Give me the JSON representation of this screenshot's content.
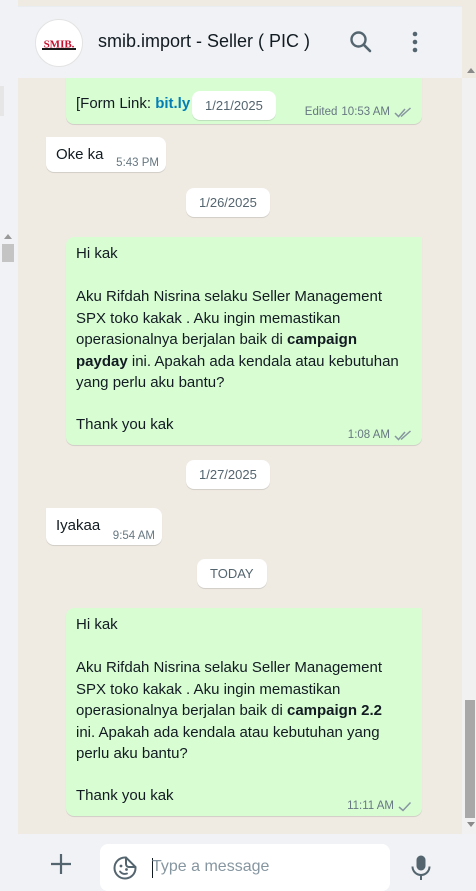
{
  "header": {
    "avatar_text": "SMIB.",
    "title": "smib.import - Seller ( PIC )",
    "search_icon": "search-icon",
    "menu_icon": "kebab-menu-icon"
  },
  "messages": {
    "m0": {
      "prefix": "[Form Link: ",
      "link": "bit.ly",
      "edited": "Edited",
      "time": "10:53 AM"
    },
    "floating_date": "1/21/2025",
    "m1": {
      "text": "Oke ka",
      "time": "5:43 PM"
    },
    "date2": "1/26/2025",
    "m2": {
      "greeting": "Hi kak",
      "l1": "Aku Rifdah Nisrina selaku Seller Management",
      "l2": "SPX toko kakak . Aku ingin memastikan",
      "l3a": "operasionalnya berjalan baik di ",
      "l3b": "campaign",
      "l4a": "payday",
      "l4b": " ini. Apakah ada kendala atau kebutuhan",
      "l5": "yang perlu aku bantu?",
      "closing": "Thank you kak",
      "time": "1:08 AM"
    },
    "date3": "1/27/2025",
    "m3": {
      "text": "Iyakaa",
      "time": "9:54 AM"
    },
    "date4": "TODAY",
    "m4": {
      "greeting": "Hi kak",
      "l1": "Aku Rifdah Nisrina selaku Seller Management",
      "l2": "SPX toko kakak . Aku ingin memastikan",
      "l3a": "operasionalnya berjalan baik di ",
      "l3b": "campaign 2.2",
      "l4": "ini. Apakah ada kendala atau kebutuhan yang",
      "l5": "perlu aku bantu?",
      "closing": "Thank you kak",
      "time": "11:11 AM"
    }
  },
  "composer": {
    "placeholder": "Type a message",
    "value": ""
  },
  "colors": {
    "outgoing_bubble": "#d9fdd3",
    "incoming_bubble": "#ffffff",
    "chat_background": "#efeae2",
    "read_tick": "#8696a0",
    "link": "#027eb5"
  }
}
